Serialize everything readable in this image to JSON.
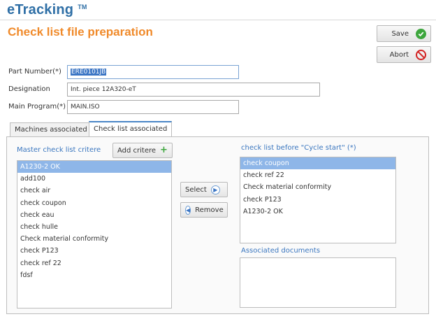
{
  "header": {
    "app_name": "eTracking",
    "trademark": "TM",
    "page_title": "Check list file preparation"
  },
  "actions": {
    "save_label": "Save",
    "abort_label": "Abort"
  },
  "form": {
    "part_number": {
      "label": "Part Number(*)",
      "value": "ERE0101JB"
    },
    "designation": {
      "label": "Designation",
      "value": "Int. piece 12A320-eT"
    },
    "main_program": {
      "label": "Main Program(*)",
      "value": "MAIN.ISO"
    }
  },
  "tabs": [
    {
      "label": "Machines associated",
      "active": false
    },
    {
      "label": "Check list associated",
      "active": true
    }
  ],
  "master": {
    "label": "Master check list critere",
    "add_button": "Add critere",
    "items": [
      "A1230-2 OK",
      "add100",
      "check air",
      "check coupon",
      "check eau",
      "check hulle",
      "Check material conformity",
      "check P123",
      "check ref 22",
      "fdsf"
    ],
    "selected_index": 0
  },
  "transfer": {
    "select_label": "Select",
    "remove_label": "Remove"
  },
  "before_cycle": {
    "label": "check list before \"Cycle start\" (*)",
    "items": [
      "check coupon",
      "check ref 22",
      "Check material conformity",
      "check P123",
      "A1230-2 OK"
    ],
    "selected_index": 0
  },
  "documents": {
    "label": "Associated documents"
  },
  "colors": {
    "brand_blue": "#2f6fa6",
    "title_orange": "#f08a2a",
    "selection_blue": "#8eb6e8",
    "save_green": "#3da63d",
    "abort_red": "#d32222"
  }
}
